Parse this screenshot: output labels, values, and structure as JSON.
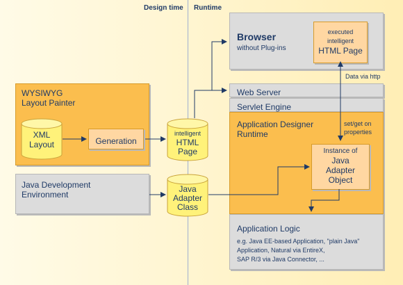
{
  "headers": {
    "design_time": "Design time",
    "runtime": "Runtime"
  },
  "browser": {
    "title": "Browser",
    "subtitle": "without Plug-ins"
  },
  "html_page_exec": {
    "line1": "executed",
    "line2": "intelligent",
    "line3": "HTML Page"
  },
  "data_via_http": "Data via http",
  "web_server": "Web Server",
  "servlet_engine": "Servlet Engine",
  "ad_runtime": {
    "line1": "Application Designer",
    "line2": "Runtime"
  },
  "set_get": {
    "line1": "set/get on",
    "line2": "properties"
  },
  "adapter_instance": {
    "line1": "Instance of",
    "line2": "Java",
    "line3": "Adapter",
    "line4": "Object"
  },
  "wysiwyg": {
    "line1": "WYSIWYG",
    "line2": "Layout Painter"
  },
  "xml_layout": {
    "line1": "XML",
    "line2": "Layout"
  },
  "generation": "Generation",
  "intelligent_html": {
    "line1": "intelligent",
    "line2": "HTML",
    "line3": "Page"
  },
  "java_dev_env": {
    "line1": "Java Development",
    "line2": "Environment"
  },
  "java_adapter_class": {
    "line1": "Java",
    "line2": "Adapter",
    "line3": "Class"
  },
  "app_logic": {
    "title": "Application Logic",
    "line1": "e.g. Java EE-based Application, \"plain Java\"",
    "line2": "Application, Natural via EntireX,",
    "line3": "SAP R/3 via Java Connector, ..."
  },
  "colors": {
    "arrow": "#1f3a66",
    "gray_box": "#dcdcdc",
    "orange_box": "#fbbe4e",
    "peach_box": "#ffd7a2",
    "cylinder": "#fff27a"
  }
}
